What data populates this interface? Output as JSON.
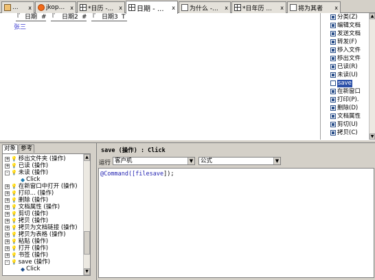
{
  "tabs": [
    {
      "label": "...",
      "icon": "home-icon",
      "active": false
    },
    {
      "label": "jkop...",
      "icon": "flower-icon",
      "active": false
    },
    {
      "label": "*日历 -...",
      "icon": "grid-icon",
      "active": false
    },
    {
      "label": "日期 - ...",
      "icon": "grid-icon",
      "active": true
    },
    {
      "label": "为什么 -...",
      "icon": "page-icon",
      "active": false
    },
    {
      "label": "*日年历 ...",
      "icon": "grid-icon",
      "active": false
    },
    {
      "label": "将为其者",
      "icon": "page-icon",
      "active": false
    }
  ],
  "tab_close": "x",
  "document": {
    "fields": [
      {
        "label": "日期",
        "end_mark": "#"
      },
      {
        "label": "日期2",
        "end_mark": "#"
      },
      {
        "label": "日期3",
        "end_mark": "T"
      }
    ],
    "field_open_mark": "『",
    "name_text": "张三"
  },
  "action_bar": {
    "items": [
      {
        "label": "分类(Z)"
      },
      {
        "label": "编辑文档"
      },
      {
        "label": "发送文档"
      },
      {
        "label": "转发(F)"
      },
      {
        "label": "移入文件"
      },
      {
        "label": "移出文件"
      },
      {
        "label": "已读(R)"
      },
      {
        "label": "未读(U)"
      },
      {
        "label": "save",
        "selected": true,
        "empty_icon": true
      },
      {
        "label": "在新窗口"
      },
      {
        "label": "打印(P)."
      },
      {
        "label": "删除(D)"
      },
      {
        "label": "文档属性"
      },
      {
        "label": "剪切(U)"
      },
      {
        "label": "拷贝(C)"
      }
    ]
  },
  "object_panel": {
    "tabs": [
      {
        "label": "对象",
        "active": true
      },
      {
        "label": "参考",
        "active": false
      }
    ],
    "tree": [
      {
        "label": "移出文件夹 (操作)",
        "expander": "+",
        "level": 0
      },
      {
        "label": "已读 (操作)",
        "expander": "+",
        "level": 0
      },
      {
        "label": "未读 (操作)",
        "expander": "-",
        "level": 0
      },
      {
        "label": "Click",
        "expander": "",
        "level": 1
      },
      {
        "label": "在新窗口中打开 (操作)",
        "expander": "+",
        "level": 0
      },
      {
        "label": "打印... (操作)",
        "expander": "+",
        "level": 0
      },
      {
        "label": "删除 (操作)",
        "expander": "+",
        "level": 0
      },
      {
        "label": "文档属性 (操作)",
        "expander": "+",
        "level": 0
      },
      {
        "label": "剪切 (操作)",
        "expander": "+",
        "level": 0
      },
      {
        "label": "拷贝 (操作)",
        "expander": "+",
        "level": 0
      },
      {
        "label": "拷贝为文档链接 (操作)",
        "expander": "+",
        "level": 0
      },
      {
        "label": "拷贝为表格 (操作)",
        "expander": "+",
        "level": 0
      },
      {
        "label": "粘贴 (操作)",
        "expander": "+",
        "level": 0
      },
      {
        "label": "打开 (操作)",
        "expander": "+",
        "level": 0
      },
      {
        "label": "书签 (操作)",
        "expander": "+",
        "level": 0
      },
      {
        "label": "save (操作)",
        "expander": "-",
        "level": 0,
        "active": true
      },
      {
        "label": "Click",
        "expander": "",
        "level": 1,
        "dark": true
      }
    ]
  },
  "code_panel": {
    "title": "save (操作) : Click",
    "run_label": "运行",
    "run_target": "客户机",
    "language": "公式",
    "code_prefix": "@Command([",
    "code_keyword": "filesave",
    "code_suffix": "]);"
  }
}
